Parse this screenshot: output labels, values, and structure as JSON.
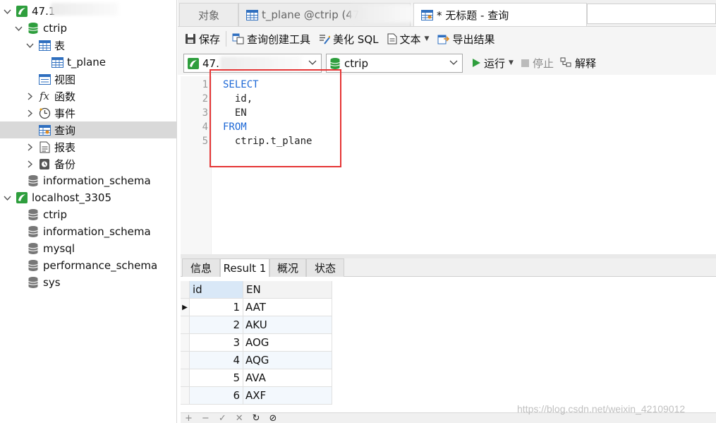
{
  "sidebar": {
    "connections": [
      {
        "label": "47.1",
        "databases": [
          {
            "label": "ctrip",
            "children": [
              {
                "label": "表",
                "children": [
                  {
                    "label": "t_plane"
                  }
                ]
              },
              {
                "label": "视图"
              },
              {
                "label": "函数"
              },
              {
                "label": "事件"
              },
              {
                "label": "查询"
              },
              {
                "label": "报表"
              },
              {
                "label": "备份"
              }
            ]
          },
          {
            "label": "information_schema"
          }
        ]
      },
      {
        "label": "localhost_3305",
        "databases": [
          {
            "label": "ctrip"
          },
          {
            "label": "information_schema"
          },
          {
            "label": "mysql"
          },
          {
            "label": "performance_schema"
          },
          {
            "label": "sys"
          }
        ]
      }
    ]
  },
  "tabs": [
    {
      "label": "对象"
    },
    {
      "label": "t_plane @ctrip (47"
    },
    {
      "label": "* 无标题 - 查询"
    }
  ],
  "toolbar": {
    "save": "保存",
    "query_builder": "查询创建工具",
    "beautify": "美化 SQL",
    "text": "文本",
    "export": "导出结果"
  },
  "toolbar2": {
    "connection_value": "47.",
    "database_value": "ctrip",
    "run": "运行",
    "stop": "停止",
    "explain": "解释"
  },
  "editor": {
    "lines": [
      {
        "num": "1",
        "text": "SELECT",
        "keyword": true
      },
      {
        "num": "2",
        "text": "  id,",
        "keyword": false
      },
      {
        "num": "3",
        "text": "  EN",
        "keyword": false
      },
      {
        "num": "4",
        "text": "FROM",
        "keyword": true
      },
      {
        "num": "5",
        "text": "  ctrip.t_plane",
        "keyword": false
      }
    ]
  },
  "result_tabs": [
    {
      "label": "信息"
    },
    {
      "label": "Result 1"
    },
    {
      "label": "概况"
    },
    {
      "label": "状态"
    }
  ],
  "grid": {
    "columns": [
      "id",
      "EN"
    ],
    "rows": [
      [
        "1",
        "AAT"
      ],
      [
        "2",
        "AKU"
      ],
      [
        "3",
        "AOG"
      ],
      [
        "4",
        "AQG"
      ],
      [
        "5",
        "AVA"
      ],
      [
        "6",
        "AXF"
      ]
    ]
  },
  "bottombar": {
    "buttons": [
      "+",
      "−",
      "✓",
      "✕",
      "↻",
      "⊘"
    ]
  },
  "watermark": "https://blog.csdn.net/weixin_42109012",
  "colors": {
    "keyword": "#1d68d6",
    "highlight_box": "#e53535",
    "selected_row": "#d9d9d9",
    "db_green": "#2e9e3d"
  },
  "icons": {
    "connection": "connection-icon",
    "database": "database-icon",
    "table": "table-icon",
    "view": "view-icon",
    "function": "function-icon",
    "event": "clock-icon",
    "query": "query-icon",
    "report": "report-icon",
    "backup": "backup-icon"
  }
}
